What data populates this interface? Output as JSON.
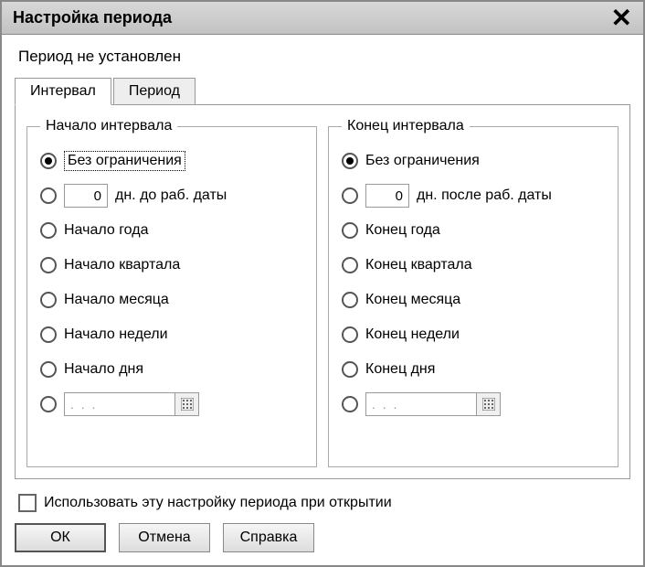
{
  "window": {
    "title": "Настройка периода",
    "close_glyph": "✕"
  },
  "status": "Период не установлен",
  "tabs": {
    "interval": "Интервал",
    "period": "Период"
  },
  "start_group": {
    "legend": "Начало интервала",
    "opt_nolimit": "Без ограничения",
    "opt_days_value": "0",
    "opt_days_label": "дн. до раб. даты",
    "opt_year": "Начало года",
    "opt_quarter": "Начало квартала",
    "opt_month": "Начало месяца",
    "opt_week": "Начало недели",
    "opt_day": "Начало дня",
    "opt_date_value": ". . ."
  },
  "end_group": {
    "legend": "Конец интервала",
    "opt_nolimit": "Без ограничения",
    "opt_days_value": "0",
    "opt_days_label": "дн. после раб. даты",
    "opt_year": "Конец года",
    "opt_quarter": "Конец квартала",
    "opt_month": "Конец месяца",
    "opt_week": "Конец недели",
    "opt_day": "Конец дня",
    "opt_date_value": ". . ."
  },
  "checkbox_label": "Использовать эту настройку периода при открытии",
  "buttons": {
    "ok": "ОК",
    "cancel": "Отмена",
    "help": "Справка"
  }
}
